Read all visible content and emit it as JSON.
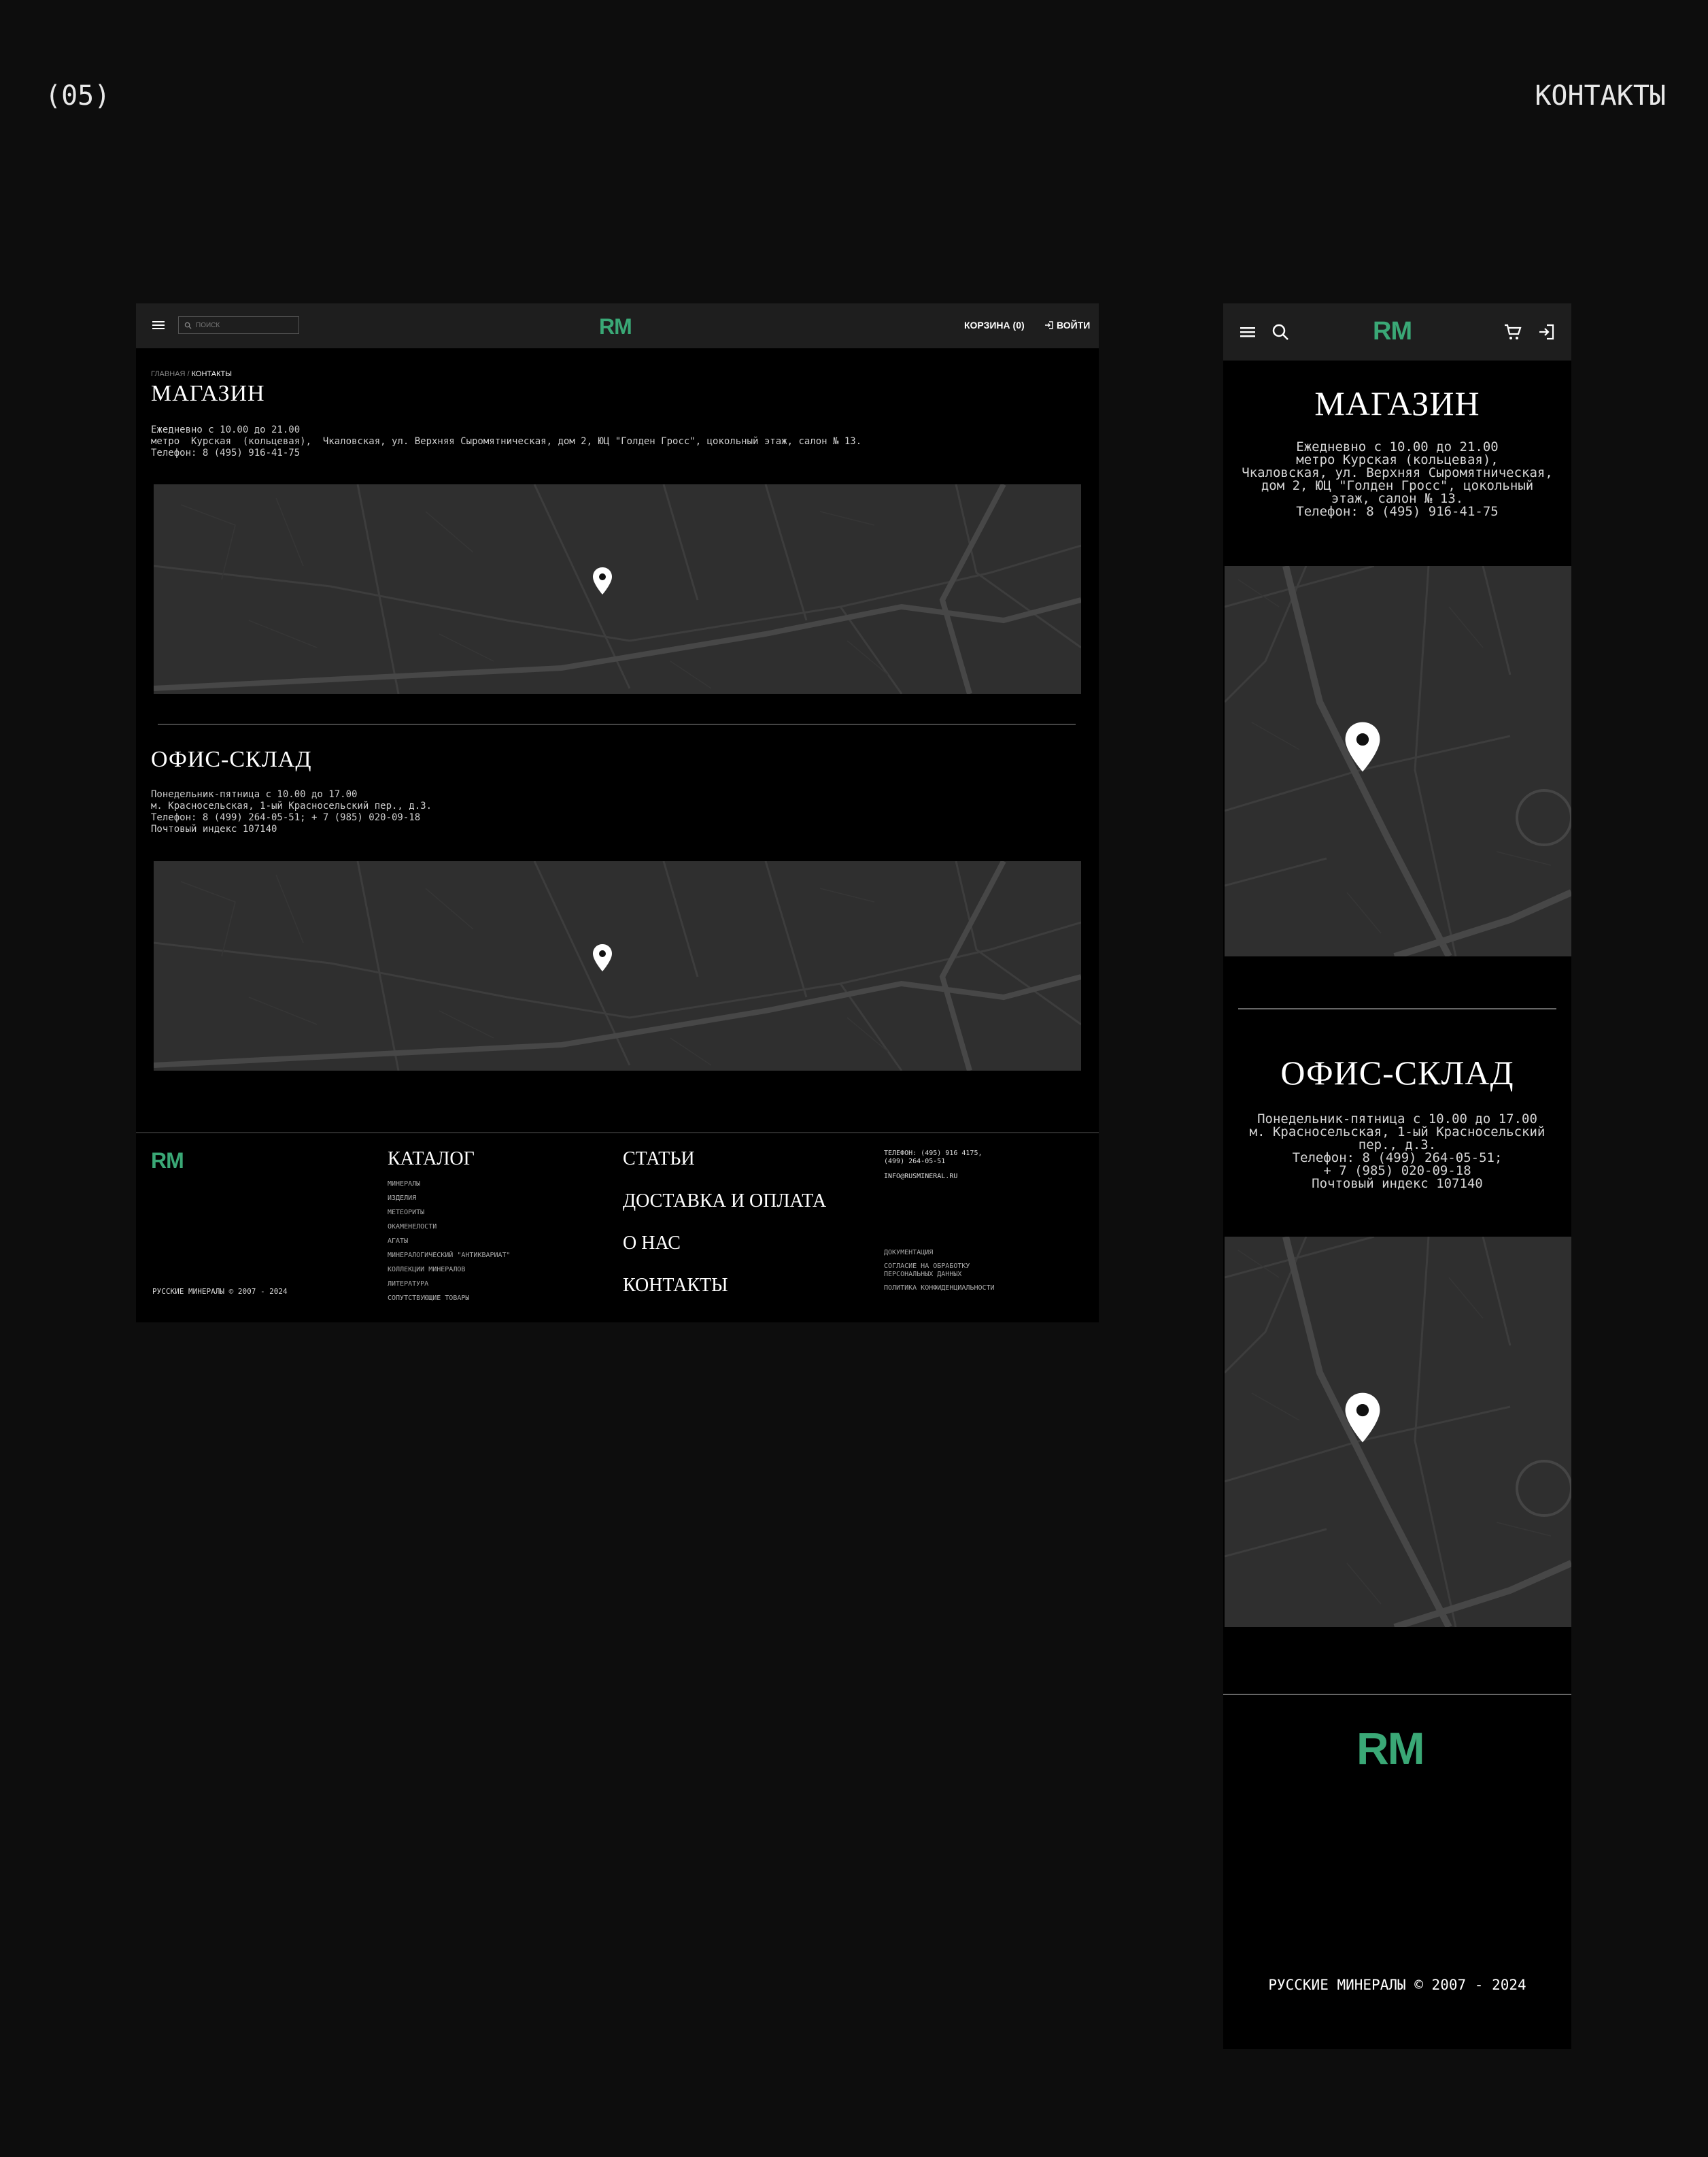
{
  "slide": {
    "number": "(05)",
    "title": "КОНТАКТЫ"
  },
  "desktop": {
    "header": {
      "search_placeholder": "ПОИСК",
      "logo": "RM",
      "cart": "КОРЗИНА (0)",
      "login": "ВОЙТИ"
    },
    "breadcrumb": {
      "home": "ГЛАВНАЯ /",
      "current": "КОНТАКТЫ"
    },
    "shop": {
      "title": "МАГАЗИН",
      "hours": "Ежедневно с 10.00 до 21.00",
      "address": "метро  Курская  (кольцевая),  Чкаловская, ул. Верхняя Сыромятническая, дом 2, ЮЦ \"Голден Гросс\", цокольный этаж, салон № 13.",
      "phone": "Телефон: 8 (495) 916-41-75"
    },
    "office": {
      "title": "ОФИС-СКЛАД",
      "hours": "Понедельник-пятница с 10.00 до 17.00",
      "address": "м. Красносельская, 1-ый Красносельский пер., д.3.",
      "phone": "Телефон: 8 (499) 264-05-51; + 7 (985) 020-09-18",
      "postcode": "Почтовый индекс 107140"
    },
    "footer": {
      "logo": "RM",
      "copyright": "РУССКИЕ МИНЕРАЛЫ © 2007 - 2024",
      "catalog_title": "КАТАЛОГ",
      "catalog_items": [
        "МИНЕРАЛЫ",
        "ИЗДЕЛИЯ",
        "МЕТЕОРИТЫ",
        "ОКАМЕНЕЛОСТИ",
        "АГАТЫ",
        "МИНЕРАЛОГИЧЕСКИЙ \"АНТИКВАРИАТ\"",
        "КОЛЛЕКЦИИ МИНЕРАЛОВ",
        "ЛИТЕРАТУРА",
        "СОПУТСТВУЮЩИЕ ТОВАРЫ"
      ],
      "nav": [
        "СТАТЬИ",
        "ДОСТАВКА И ОПЛАТА",
        "О НАС",
        "КОНТАКТЫ"
      ],
      "phone_line1": "ТЕЛЕФОН: (495) 916 4175,",
      "phone_line2": "(499) 264-05-51",
      "email": "INFO@RUSMINERAL.RU",
      "docs_title": "ДОКУМЕНТАЦИЯ",
      "consent_line1": "СОГЛАСИЕ НА ОБРАБОТКУ",
      "consent_line2": "ПЕРСОНАЛЬНЫХ ДАННЫХ",
      "privacy": "ПОЛИТИКА КОНФИДЕНЦИАЛЬНОСТИ"
    }
  },
  "mobile": {
    "header": {
      "logo": "RM"
    },
    "shop": {
      "title": "МАГАЗИН",
      "line1": "Ежедневно с 10.00 до 21.00",
      "line2": "метро  Курская  (кольцевая),",
      "line3": "Чкаловская, ул. Верхняя Сыромятническая,",
      "line4": "дом 2, ЮЦ \"Голден Гросс\", цокольный",
      "line5": "этаж, салон № 13.",
      "line6": "Телефон: 8 (495) 916-41-75"
    },
    "office": {
      "title": "ОФИС-СКЛАД",
      "line1": "Понедельник-пятница с 10.00 до 17.00",
      "line2": "м. Красносельская, 1-ый Красносельский",
      "line3": "пер., д.3.",
      "line4": "Телефон: 8 (499) 264-05-51;",
      "line5": "+ 7 (985) 020-09-18",
      "line6": "Почтовый индекс 107140"
    },
    "footer": {
      "logo": "RM",
      "copyright": "РУССКИЕ МИНЕРАЛЫ © 2007 - 2024"
    }
  },
  "colors": {
    "background": "#0d0d0d",
    "panel": "#000000",
    "header": "#1e1e1e",
    "brand_green": "#3aa876",
    "map": "#2f2f2f"
  }
}
